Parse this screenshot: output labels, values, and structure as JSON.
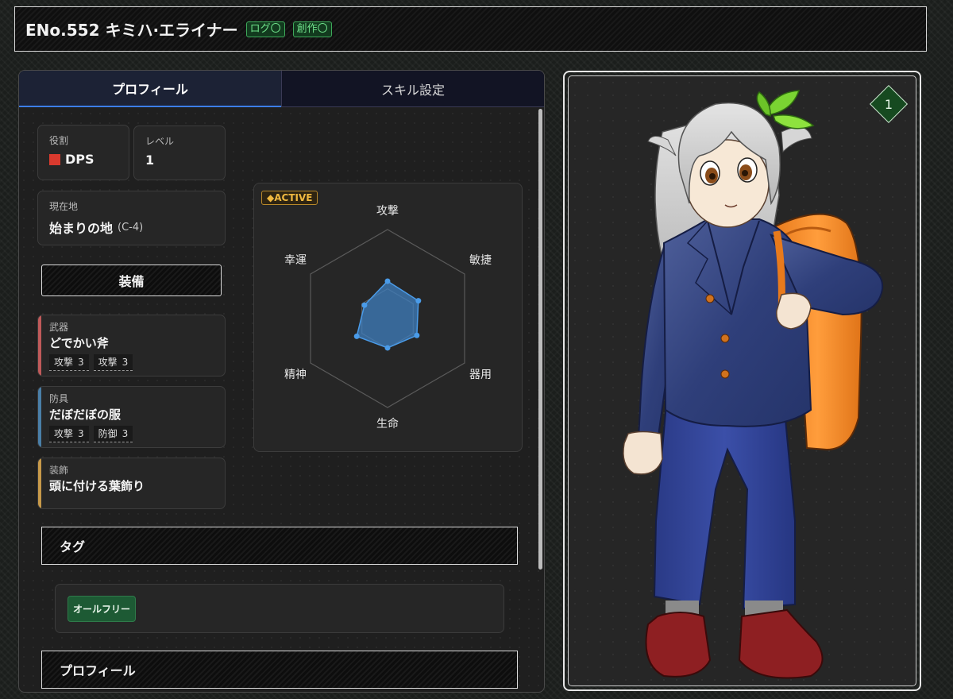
{
  "header": {
    "character_title": "ENo.552 キミハ·エライナー",
    "badges": [
      "ログ〇",
      "創作〇"
    ]
  },
  "tabs": [
    {
      "label": "プロフィール",
      "active": true
    },
    {
      "label": "スキル設定",
      "active": false
    }
  ],
  "profile": {
    "role": {
      "label": "役割",
      "value": "DPS",
      "color": "#d93a2e"
    },
    "level": {
      "label": "レベル",
      "value": "1"
    },
    "location": {
      "label": "現在地",
      "value": "始まりの地",
      "coord": "(C-4)"
    }
  },
  "equipment": {
    "header": "装備",
    "items": [
      {
        "type": "武器",
        "name": "どでかい斧",
        "accent": "#c05a5a",
        "stats": [
          {
            "name": "攻撃",
            "value": "3"
          },
          {
            "name": "攻撃",
            "value": "3"
          }
        ]
      },
      {
        "type": "防具",
        "name": "だぼだぼの服",
        "accent": "#4a7fa8",
        "stats": [
          {
            "name": "攻撃",
            "value": "3"
          },
          {
            "name": "防御",
            "value": "3"
          }
        ]
      },
      {
        "type": "装飾",
        "name": "頭に付ける葉飾り",
        "accent": "#c89a4a",
        "stats": []
      }
    ]
  },
  "radar": {
    "badge": "◆ACTIVE",
    "axes": [
      "攻撃",
      "敏捷",
      "器用",
      "生命",
      "精神",
      "幸運"
    ],
    "levels": 3,
    "values": [
      0.42,
      0.4,
      0.38,
      0.33,
      0.4,
      0.3
    ],
    "fill_color": "#3f7fbf",
    "point_color": "#4a9be8"
  },
  "tags": {
    "header": "タグ",
    "items": [
      "オールフリー"
    ]
  },
  "profile_section": {
    "header": "プロフィール"
  },
  "portrait": {
    "level": "1"
  }
}
